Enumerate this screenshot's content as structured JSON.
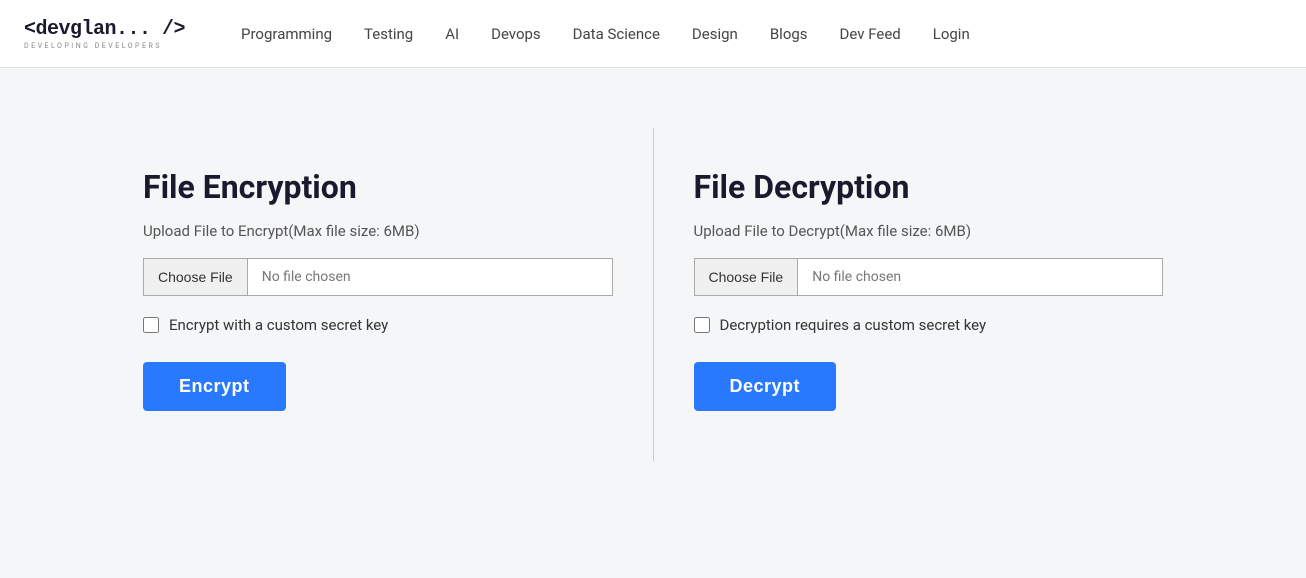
{
  "navbar": {
    "logo_main": "<devglan... />",
    "logo_sub": "Developing Developers",
    "nav_items": [
      {
        "label": "Programming",
        "href": "#"
      },
      {
        "label": "Testing",
        "href": "#"
      },
      {
        "label": "AI",
        "href": "#"
      },
      {
        "label": "Devops",
        "href": "#"
      },
      {
        "label": "Data Science",
        "href": "#"
      },
      {
        "label": "Design",
        "href": "#"
      },
      {
        "label": "Blogs",
        "href": "#"
      },
      {
        "label": "Dev Feed",
        "href": "#"
      },
      {
        "label": "Login",
        "href": "#"
      }
    ]
  },
  "encryption_panel": {
    "title": "File Encryption",
    "subtitle": "Upload File to Encrypt(Max file size: 6MB)",
    "choose_file_label": "Choose File",
    "no_file_text": "No file chosen",
    "checkbox_label": "Encrypt with a custom secret key",
    "button_label": "Encrypt"
  },
  "decryption_panel": {
    "title": "File Decryption",
    "subtitle": "Upload File to Decrypt(Max file size: 6MB)",
    "choose_file_label": "Choose File",
    "no_file_text": "No file chosen",
    "checkbox_label": "Decryption requires a custom secret key",
    "button_label": "Decrypt"
  }
}
